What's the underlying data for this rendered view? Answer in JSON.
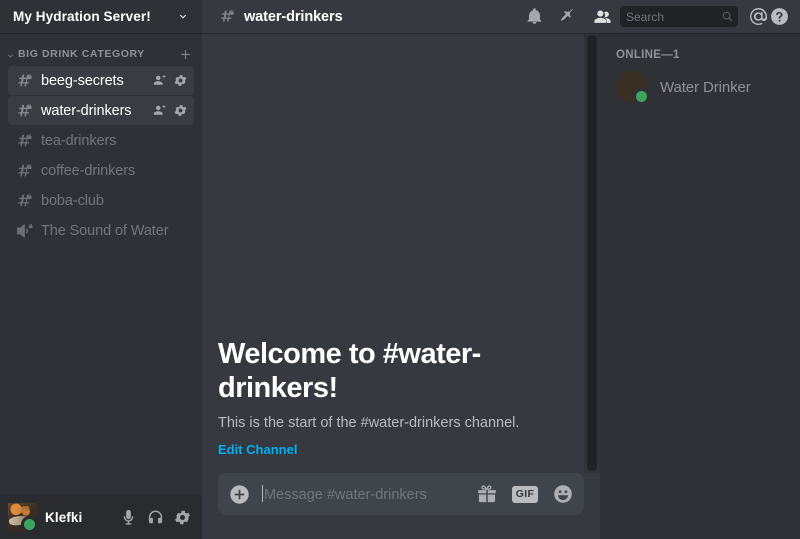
{
  "server": {
    "name": "My Hydration Server!",
    "dropdown_icon": "chevron-down-icon"
  },
  "sidebar": {
    "category": {
      "label": "BIG DRINK CATEGORY",
      "collapse_icon": "chevron-down-icon",
      "add_icon": "plus-icon"
    },
    "channels": [
      {
        "name": "beeg-secrets",
        "type": "text",
        "private": true,
        "state": "unread",
        "actions": [
          "invite-icon",
          "gear-icon"
        ]
      },
      {
        "name": "water-drinkers",
        "type": "text",
        "private": true,
        "state": "selected",
        "actions": [
          "invite-icon",
          "gear-icon"
        ]
      },
      {
        "name": "tea-drinkers",
        "type": "text",
        "private": true,
        "state": "muted",
        "actions": []
      },
      {
        "name": "coffee-drinkers",
        "type": "text",
        "private": true,
        "state": "muted",
        "actions": []
      },
      {
        "name": "boba-club",
        "type": "text",
        "private": true,
        "state": "muted",
        "actions": []
      },
      {
        "name": "The Sound of Water",
        "type": "voice",
        "private": true,
        "state": "muted",
        "actions": []
      }
    ]
  },
  "user_panel": {
    "username": "Klefki",
    "status": "online",
    "actions": [
      {
        "icon": "microphone-icon",
        "name": "mute-button"
      },
      {
        "icon": "headphones-icon",
        "name": "deafen-button"
      },
      {
        "icon": "gear-icon",
        "name": "user-settings-button"
      }
    ]
  },
  "topbar": {
    "channel_name": "water-drinkers",
    "channel_icon": "hash-lock-icon",
    "icons": [
      {
        "icon": "bell-icon",
        "name": "notification-settings-button"
      },
      {
        "icon": "pin-icon",
        "name": "pinned-messages-button"
      },
      {
        "icon": "members-icon",
        "name": "member-list-toggle-button"
      }
    ],
    "search": {
      "placeholder": "Search",
      "value": "",
      "icon": "search-icon"
    },
    "mentions_icon": "at-icon",
    "help_icon": "help-icon"
  },
  "main": {
    "welcome_title": "Welcome to #water-drinkers!",
    "welcome_subtitle": "This is the start of the #water-drinkers channel.",
    "edit_channel_link": "Edit Channel"
  },
  "composer": {
    "placeholder": "Message #water-drinkers",
    "value": "",
    "add_icon": "plus-circle-icon",
    "gift_icon": "gift-icon",
    "gif_label": "GIF",
    "emoji_icon": "emoji-icon"
  },
  "members": {
    "header": "ONLINE—1",
    "list": [
      {
        "name": "Water Drinker",
        "status": "online"
      }
    ]
  },
  "colors": {
    "sidebar_bg": "#2f3136",
    "main_bg": "#36393f",
    "user_panel_bg": "#292b2f",
    "accent_link": "#00aff4",
    "online_green": "#3ba55d",
    "text_muted": "#8e9297",
    "text_primary": "#ffffff",
    "active_channel_bg": "#393c43"
  }
}
